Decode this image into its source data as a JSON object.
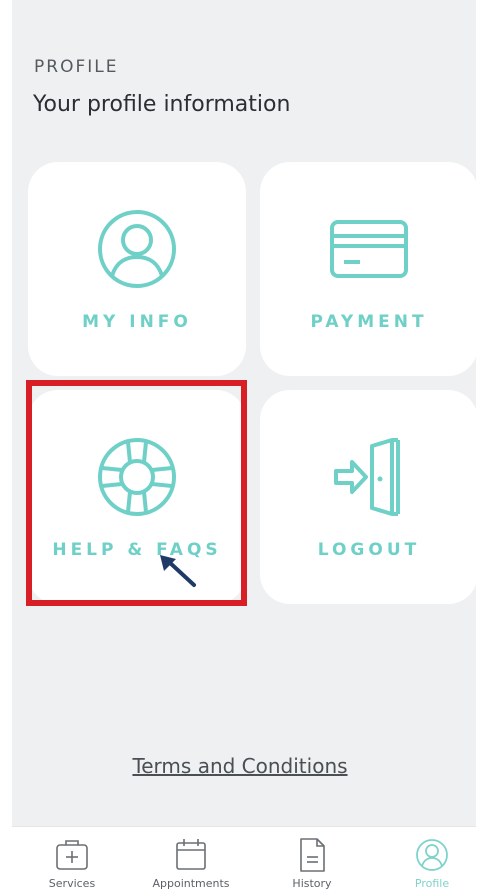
{
  "header": {
    "section_label": "PROFILE",
    "title": "Your profile information"
  },
  "tiles": [
    {
      "label": "MY INFO",
      "icon": "user-icon"
    },
    {
      "label": "PAYMENT",
      "icon": "credit-card-icon"
    },
    {
      "label": "HELP & FAQS",
      "icon": "lifebuoy-icon"
    },
    {
      "label": "LOGOUT",
      "icon": "logout-door-icon"
    }
  ],
  "footer": {
    "terms_link": "Terms and Conditions"
  },
  "tabbar": {
    "items": [
      {
        "label": "Services",
        "icon": "medical-bag-icon"
      },
      {
        "label": "Appointments",
        "icon": "calendar-icon"
      },
      {
        "label": "History",
        "icon": "document-icon"
      },
      {
        "label": "Profile",
        "icon": "user-circle-icon",
        "active": true
      }
    ]
  },
  "colors": {
    "accent": "#6fd0c7",
    "highlight": "#d81f26",
    "pointer_arrow": "#1f3a66",
    "background": "#eff0f1"
  }
}
